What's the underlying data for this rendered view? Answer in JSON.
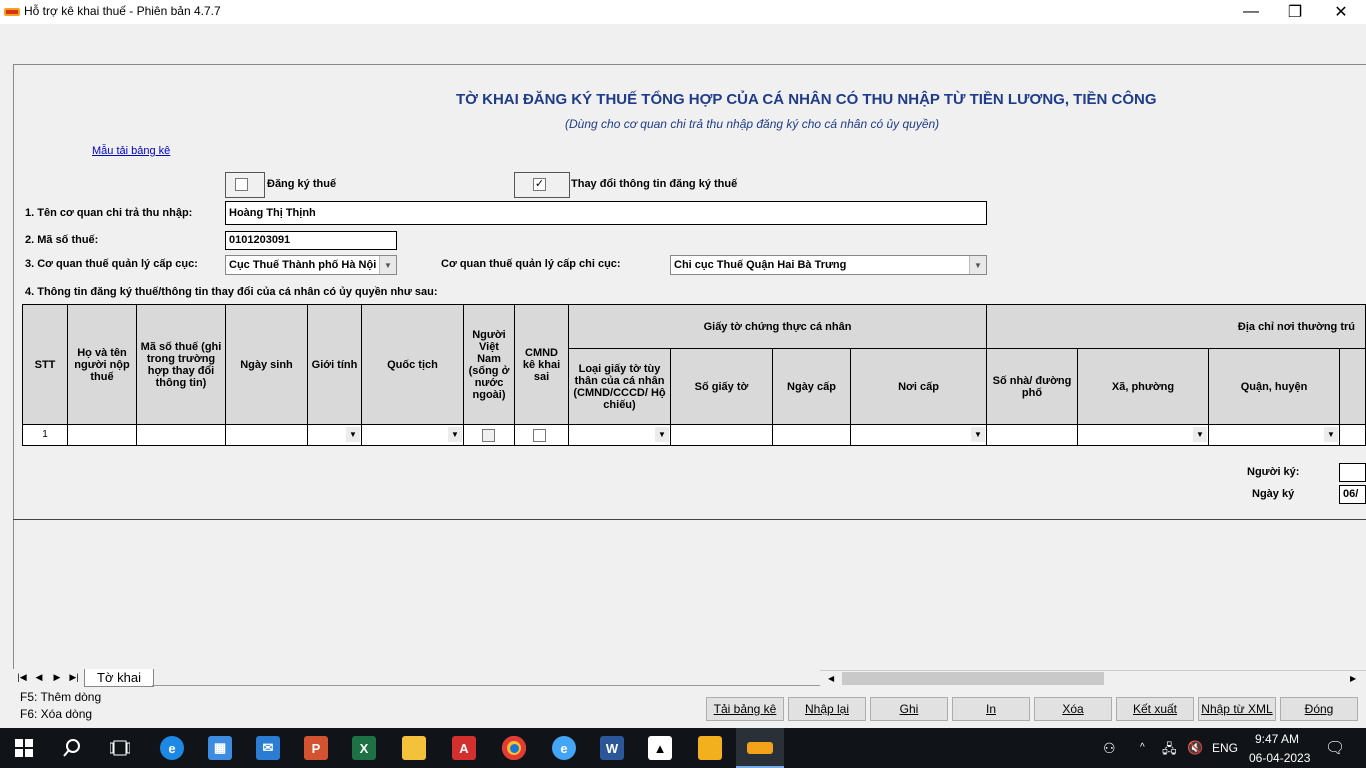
{
  "window": {
    "title": "Hỗ trợ kê khai thuế -  Phiên bản 4.7.7",
    "minimize": "—",
    "restore": "❐",
    "close": "✕"
  },
  "form": {
    "title": "TỜ KHAI ĐĂNG KÝ THUẾ TỔNG HỢP CỦA CÁ NHÂN CÓ THU NHẬP TỪ TIỀN LƯƠNG, TIỀN CÔNG",
    "subtitle": "(Dùng cho cơ quan chi trả thu nhập đăng ký cho cá nhân có ủy quyền)",
    "template_link": "Mẫu tải bảng kê",
    "register_label": "Đăng ký thuế",
    "register_checked": false,
    "change_label": "Thay đổi thông tin đăng ký thuế",
    "change_checked": true,
    "change_mark": "✓",
    "org_name_label": "1. Tên cơ quan chi trả thu nhập:",
    "org_name_value": "Hoàng Thị Thịnh",
    "tax_code_label": "2. Mã số thuế:",
    "tax_code_value": "0101203091",
    "dept_label": "3. Cơ quan thuế quản lý cấp cục:",
    "dept_value": "Cục Thuế Thành phố Hà Nội",
    "subdept_label": "Cơ quan thuế quản lý cấp chi cục:",
    "subdept_value": "Chi cục Thuế Quận Hai Bà Trưng",
    "section4_label": "4. Thông tin đăng ký thuế/thông tin thay đổi của cá nhân có ủy quyền như sau:",
    "signer_label": "Người ký:",
    "sign_date_label": "Ngày ký",
    "sign_date_value": "06/"
  },
  "table": {
    "headers": {
      "stt": "STT",
      "name": "Họ và tên người nộp thuế",
      "tax_code": "Mã số thuế (ghi trong trường hợp thay đổi thông tin)",
      "dob": "Ngày sinh",
      "gender": "Giới tính",
      "nationality": "Quốc tịch",
      "vn_abroad": "Người Việt Nam (sống ở nước ngoài)",
      "id_wrong": "CMND kê khai sai",
      "id_docs_group": "Giấy tờ chứng thực cá nhân",
      "id_type": "Loại giấy tờ tùy thân của cá nhân (CMND/CCCD/ Hộ chiếu)",
      "id_number": "Số giấy tờ",
      "issue_date": "Ngày cấp",
      "issue_place": "Nơi cấp",
      "address_group": "Địa chỉ nơi thường trú",
      "house_no": "Số nhà/ đường phố",
      "ward": "Xã, phường",
      "district": "Quận, huyện"
    },
    "rows": [
      {
        "stt": "1"
      }
    ],
    "dropdown_glyph": "▼"
  },
  "bottom": {
    "nav": [
      "|◀",
      "◀",
      "▶",
      "▶|"
    ],
    "sheet_tab": "Tờ khai",
    "hotkey_add": "F5: Thêm dòng",
    "hotkey_delete": "F6: Xóa dòng",
    "buttons": {
      "load": "Tải bảng kê",
      "reset": "Nhập lại",
      "save": "Ghi",
      "print": "In",
      "delete": "Xóa",
      "export": "Kết xuất",
      "import_xml": "Nhập từ XML",
      "close": "Đóng"
    }
  },
  "taskbar": {
    "time": "9:47 AM",
    "date": "06-04-2023",
    "lang": "ENG",
    "icons": [
      "windows-start",
      "search",
      "task-view",
      "edge",
      "store",
      "mail",
      "powerpoint",
      "excel",
      "file-explorer",
      "acrobat",
      "chrome",
      "internet-explorer",
      "word",
      "photos",
      "paint",
      "htkk-app"
    ]
  }
}
